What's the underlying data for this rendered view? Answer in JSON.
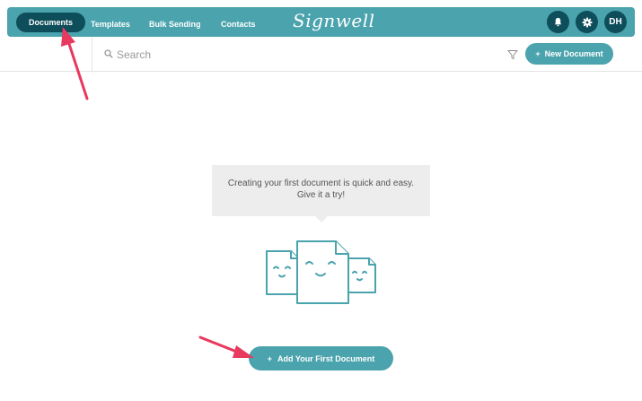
{
  "nav": {
    "items": [
      {
        "label": "Documents",
        "active": true
      },
      {
        "label": "Templates",
        "active": false
      },
      {
        "label": "Bulk Sending",
        "active": false
      },
      {
        "label": "Contacts",
        "active": false
      }
    ],
    "logo_text": "Signwell",
    "user_initials": "DH",
    "icons": [
      "bell-icon",
      "gear-icon"
    ]
  },
  "search": {
    "placeholder": "Search",
    "value": ""
  },
  "toolbar": {
    "new_document_label": "New Document",
    "plus": "+"
  },
  "empty_state": {
    "message": "Creating your first document is quick and easy. Give it a try!",
    "button_label": "Add Your First Document",
    "plus": "+"
  },
  "colors": {
    "brand": "#4aa3ad",
    "nav_active": "#0e4d5a",
    "annotation_arrow": "#e8395f"
  }
}
